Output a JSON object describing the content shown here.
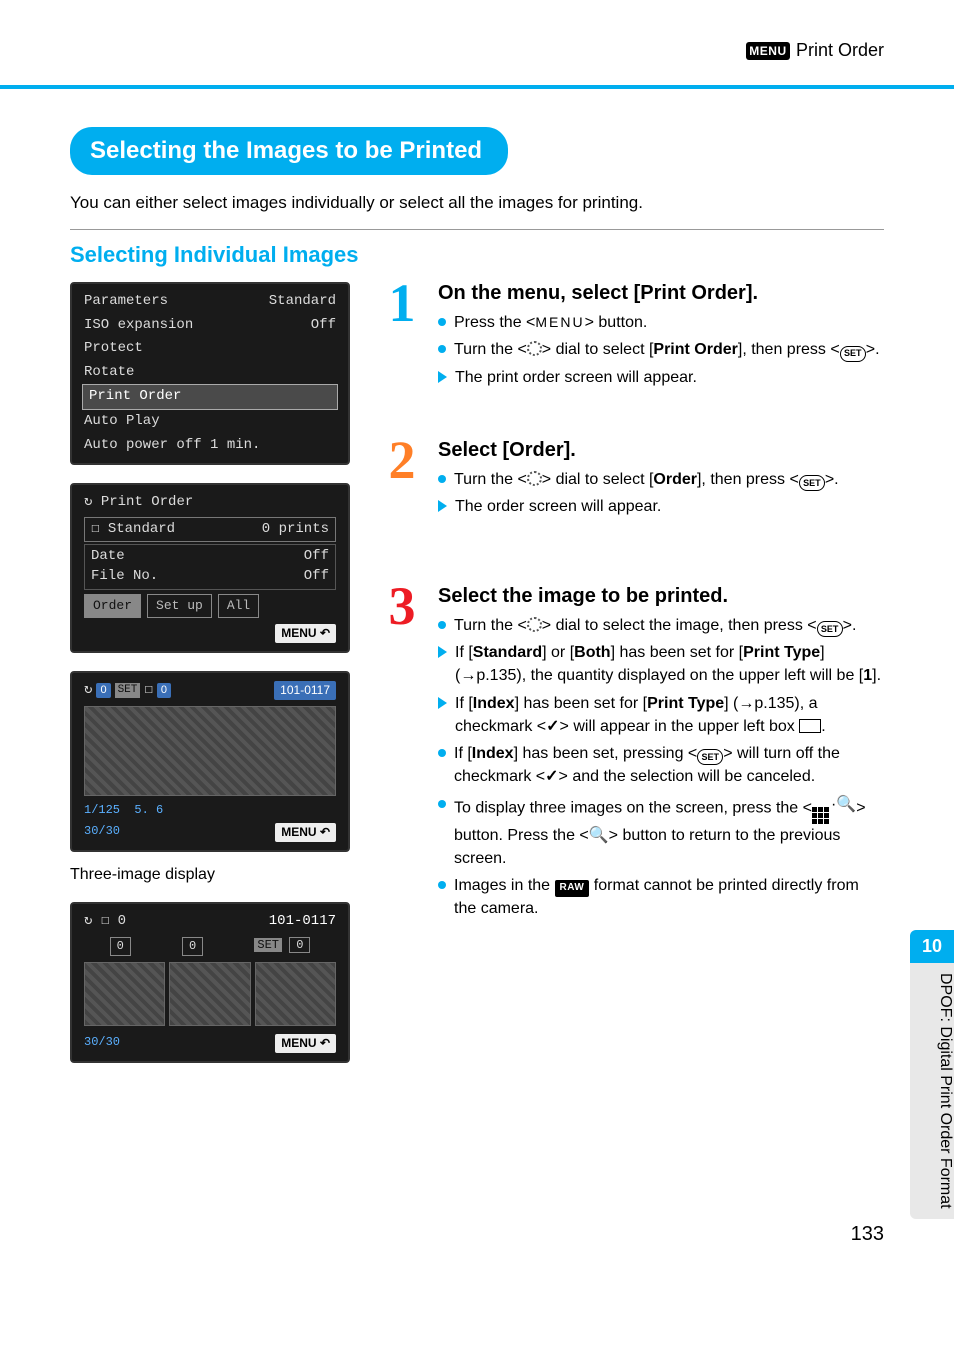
{
  "header": {
    "menu_chip": "MENU",
    "title": "Print Order"
  },
  "section_title": "Selecting the Images to be Printed",
  "intro": "You can either select images individually or select all the images for printing.",
  "sub_title": "Selecting Individual Images",
  "lcd1": {
    "r1a": "Parameters",
    "r1b": "Standard",
    "r2a": "ISO expansion",
    "r2b": "Off",
    "r3": "Protect",
    "r4": "Rotate",
    "r5": "Print Order",
    "r6": "Auto Play",
    "r7": "Auto power off 1 min."
  },
  "lcd2": {
    "title_icon": "↻",
    "title": "Print Order",
    "row1a": "Standard",
    "row1b": "0 prints",
    "row2a": "Date",
    "row2b": "Off",
    "row3a": "File No.",
    "row3b": "Off",
    "tab1": "Order",
    "tab2": "Set up",
    "tab3": "All",
    "menu": "MENU"
  },
  "lcd3": {
    "top_left_a": "0",
    "top_left_b": "SET",
    "top_left_c": "0",
    "folder": "101-0117",
    "shutter": "1/125",
    "aperture": "5. 6",
    "counter": "30/30",
    "menu": "MENU"
  },
  "caption3": "Three-image display",
  "lcd4": {
    "top_left": "0",
    "folder": "101-0117",
    "c1": "0",
    "c2": "0",
    "c3_set": "SET",
    "c3": "0",
    "counter": "30/30",
    "menu": "MENU"
  },
  "step1": {
    "title": "On the menu, select [Print Order].",
    "b1_pre": "Press the <",
    "b1_menu": "MENU",
    "b1_post": "> button.",
    "b2_pre": "Turn the <",
    "b2_mid": "> dial to select [",
    "b2_bold": "Print Order",
    "b2_post": "], then press <",
    "b2_end": ">.",
    "b3": "The print order screen will appear."
  },
  "step2": {
    "title": "Select [Order].",
    "b1_pre": "Turn the <",
    "b1_mid": "> dial to select [",
    "b1_bold": "Order",
    "b1_post": "], then press <",
    "b1_end": ">.",
    "b2": "The order screen will appear."
  },
  "step3": {
    "title": "Select the image to be printed.",
    "b1_pre": "Turn the <",
    "b1_mid": "> dial to select the image, then press <",
    "b1_end": ">.",
    "b2_pre": "If [",
    "b2_s": "Standard",
    "b2_mid1": "] or [",
    "b2_b": "Both",
    "b2_mid2": "] has been set for [",
    "b2_pt": "Print Type",
    "b2_post": "] (→p.135), the quantity displayed on the upper left will be [",
    "b2_one": "1",
    "b2_close": "].",
    "b3_pre": "If [",
    "b3_i": "Index",
    "b3_mid": "] has been set for [",
    "b3_pt": "Print Type",
    "b3_post1": "] (→p.135), a checkmark <",
    "b3_post2": "> will appear in the upper left box ",
    "b3_post3": ".",
    "b4_pre": "If [",
    "b4_i": "Index",
    "b4_mid": "] has been set, pressing <",
    "b4_mid2": "> will turn off the checkmark <",
    "b4_post": "> and the selection will be canceled.",
    "b5_pre": "To display three images on the screen, press the <",
    "b5_mid": "> button. Press the <",
    "b5_post": "> button to return to the previous screen.",
    "b6_pre": "Images in the ",
    "b6_raw": "RAW",
    "b6_post": " format cannot be printed directly from the camera."
  },
  "sidebar": {
    "num": "10",
    "label": "DPOF: Digital Print Order Format"
  },
  "page_number": "133"
}
